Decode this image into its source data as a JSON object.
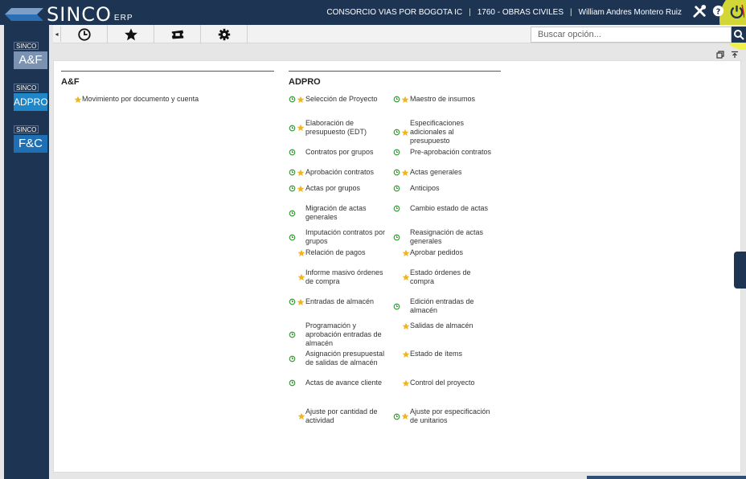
{
  "header": {
    "app_name": "SINCO",
    "app_suffix": "ERP",
    "company": "CONSORCIO VIAS POR BOGOTA IC",
    "project": "1760 - OBRAS CIVILES",
    "user": "William Andres Montero Ruiz"
  },
  "sidebar": {
    "modules": [
      {
        "tag": "SINCO",
        "name": "A&F",
        "color": "#7b93b3"
      },
      {
        "tag": "SINCO",
        "name": "ADPRO",
        "color": "#1f87c7"
      },
      {
        "tag": "SINCO",
        "name": "F&C",
        "color": "#1f6fb4"
      }
    ]
  },
  "toolbar": {
    "buttons": [
      "clock-icon",
      "star-icon",
      "ticket-icon",
      "gear-icon"
    ],
    "search_placeholder": "Buscar opción..."
  },
  "columns": [
    {
      "title": "A&F",
      "items": [
        {
          "label": "Movimiento por documento y cuenta",
          "recent": false,
          "favorite": true
        }
      ]
    },
    {
      "title": "ADPRO",
      "items": [
        {
          "label": "Selección de Proyecto",
          "recent": true,
          "favorite": true
        },
        {
          "label": "Maestro de insumos",
          "recent": true,
          "favorite": true
        },
        {
          "label": "Elaboración de presupuesto (EDT)",
          "recent": true,
          "favorite": true
        },
        {
          "label": "Especificaciones adicionales al presupuesto",
          "recent": true,
          "favorite": true
        },
        {
          "label": "Contratos por grupos",
          "recent": true,
          "favorite": false
        },
        {
          "label": "Pre-aprobación contratos",
          "recent": true,
          "favorite": false
        },
        {
          "label": "Aprobación contratos",
          "recent": true,
          "favorite": true
        },
        {
          "label": "Actas generales",
          "recent": true,
          "favorite": true
        },
        {
          "label": "Actas por grupos",
          "recent": true,
          "favorite": true
        },
        {
          "label": "Anticipos",
          "recent": true,
          "favorite": false
        },
        {
          "label": "Migración de actas generales",
          "recent": true,
          "favorite": false
        },
        {
          "label": "Cambio estado de actas",
          "recent": true,
          "favorite": false
        },
        {
          "label": "Imputación contratos por grupos",
          "recent": true,
          "favorite": false
        },
        {
          "label": "Reasignación de actas generales",
          "recent": true,
          "favorite": false
        },
        {
          "label": "Relación de pagos",
          "recent": false,
          "favorite": true
        },
        {
          "label": "Aprobar pedidos",
          "recent": false,
          "favorite": true
        },
        {
          "label": "Informe masivo órdenes de compra",
          "recent": false,
          "favorite": true
        },
        {
          "label": "Estado órdenes de compra",
          "recent": false,
          "favorite": true
        },
        {
          "label": "Entradas de almacén",
          "recent": true,
          "favorite": true
        },
        {
          "label": "Edición entradas de almacén",
          "recent": true,
          "favorite": false
        },
        {
          "label": "Programación y aprobación entradas de almacén",
          "recent": true,
          "favorite": false
        },
        {
          "label": "Salidas de almacén",
          "recent": false,
          "favorite": true
        },
        {
          "label": "Asignación presupuestal de salidas de almacén",
          "recent": true,
          "favorite": false
        },
        {
          "label": "Estado de ítems",
          "recent": false,
          "favorite": true
        },
        {
          "label": "Actas de avance cliente",
          "recent": true,
          "favorite": false
        },
        {
          "label": "Control del proyecto",
          "recent": false,
          "favorite": true
        },
        {
          "label": "Ajuste por cantidad de actividad",
          "recent": false,
          "favorite": true
        },
        {
          "label": "Ajuste por especificación de unitarios",
          "recent": true,
          "favorite": true
        }
      ]
    }
  ],
  "colors": {
    "navy": "#1d3553",
    "clock": "#3a9a3a",
    "star": "#f0b41c"
  }
}
